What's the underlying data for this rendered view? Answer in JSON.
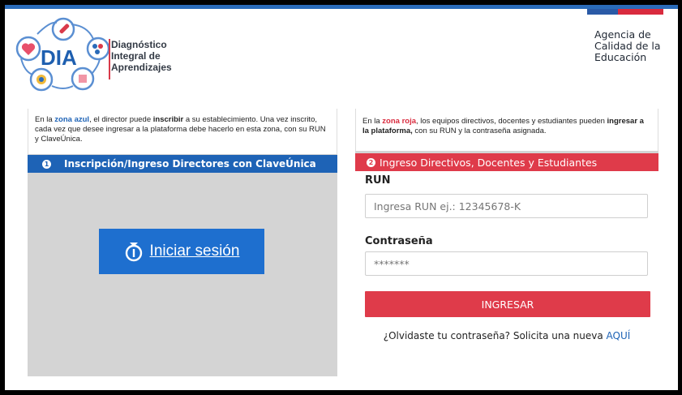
{
  "header": {
    "logo_wordmark": "DIA",
    "logo_title_lines": [
      "Diagnóstico",
      "Integral de",
      "Aprendizajes"
    ],
    "agency_lines": [
      "Agencia de",
      "Calidad de la",
      "Educación"
    ]
  },
  "left_panel": {
    "info_parts": [
      "En la ",
      "zona azul",
      ", el director puede ",
      "inscribir",
      " a su establecimiento. Una vez inscrito, cada vez que desee ingresar a la plataforma debe hacerlo en esta zona, con su RUN y ClaveÚnica."
    ],
    "bar_number": "1",
    "bar_title": "Inscripción/Ingreso Directores con ClaveÚnica",
    "login_label": "Iniciar sesión"
  },
  "right_panel": {
    "info_parts": [
      "En la ",
      "zona roja",
      ", los equipos directivos, docentes y estudiantes pueden ",
      "ingresar a la plataforma,",
      " con su RUN y la contraseña asignada."
    ],
    "bar_number": "2",
    "bar_title": "Ingreso Directivos, Docentes y Estudiantes",
    "run_label": "RUN",
    "run_placeholder": "Ingresa RUN ej.: 12345678-K",
    "password_label": "Contraseña",
    "password_placeholder": "*******",
    "submit_label": "INGRESAR",
    "forgot_text": "¿Olvidaste tu contraseña? Solicita una nueva ",
    "forgot_link": "AQUÍ"
  },
  "colors": {
    "blue": "#1e63b6",
    "red": "#df3b4a"
  }
}
